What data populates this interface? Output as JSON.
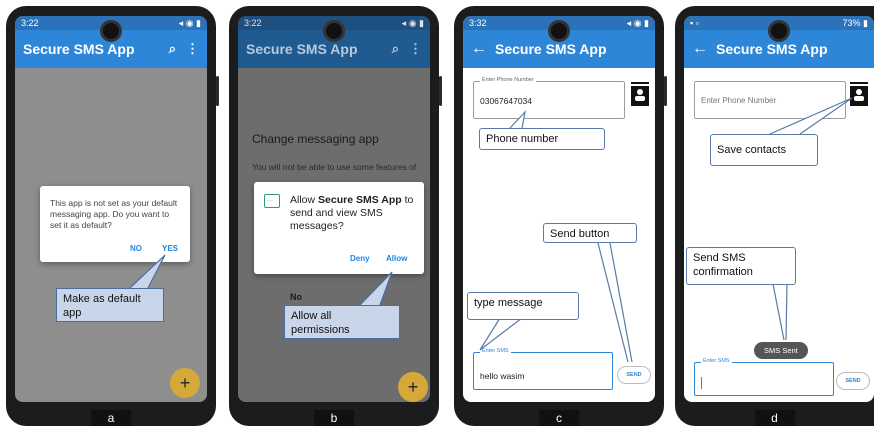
{
  "phones": {
    "a": {
      "status_time": "3:22",
      "app_title": "Secure SMS App",
      "dialog_text": "This app is not set as your default messaging app. Do you want to set it as default?",
      "btn_no": "NO",
      "btn_yes": "YES",
      "fab": "+",
      "callout": "Make as default app",
      "label": "a"
    },
    "b": {
      "status_time": "3:22",
      "app_title": "Secure SMS App",
      "bg_title": "Change messaging app",
      "bg_text": "You will not be able to use some features of",
      "dialog_text_pre": "Allow ",
      "dialog_app": "Secure SMS App",
      "dialog_text_post": " to send and view SMS messages?",
      "btn_deny": "Deny",
      "btn_allow": "Allow",
      "bg_no": "No",
      "fab": "+",
      "callout": "Allow all permissions",
      "label": "b"
    },
    "c": {
      "status_time": "3:32",
      "app_title": "Secure SMS App",
      "phone_legend": "Enter Phone Number",
      "phone_value": "03067647034",
      "sms_legend": "Enter SMS",
      "sms_value": "hello wasim",
      "send": "SEND",
      "callout_phone": "Phone number",
      "callout_send": "Send button",
      "callout_type": "type message",
      "label": "c"
    },
    "d": {
      "status_battery": "73%",
      "app_title": "Secure SMS App",
      "phone_placeholder": "Enter Phone Number",
      "sms_legend": "Enter SMS",
      "send": "SEND",
      "toast": "SMS Sent",
      "callout_contacts": "Save contacts",
      "callout_confirm": "Send SMS confirmation",
      "label": "d"
    }
  },
  "colors": {
    "appbar": "#2e86d9",
    "fab": "#d4a93a",
    "callout_border": "#5a7aa8",
    "callout_fill": "#c9d5e8"
  }
}
